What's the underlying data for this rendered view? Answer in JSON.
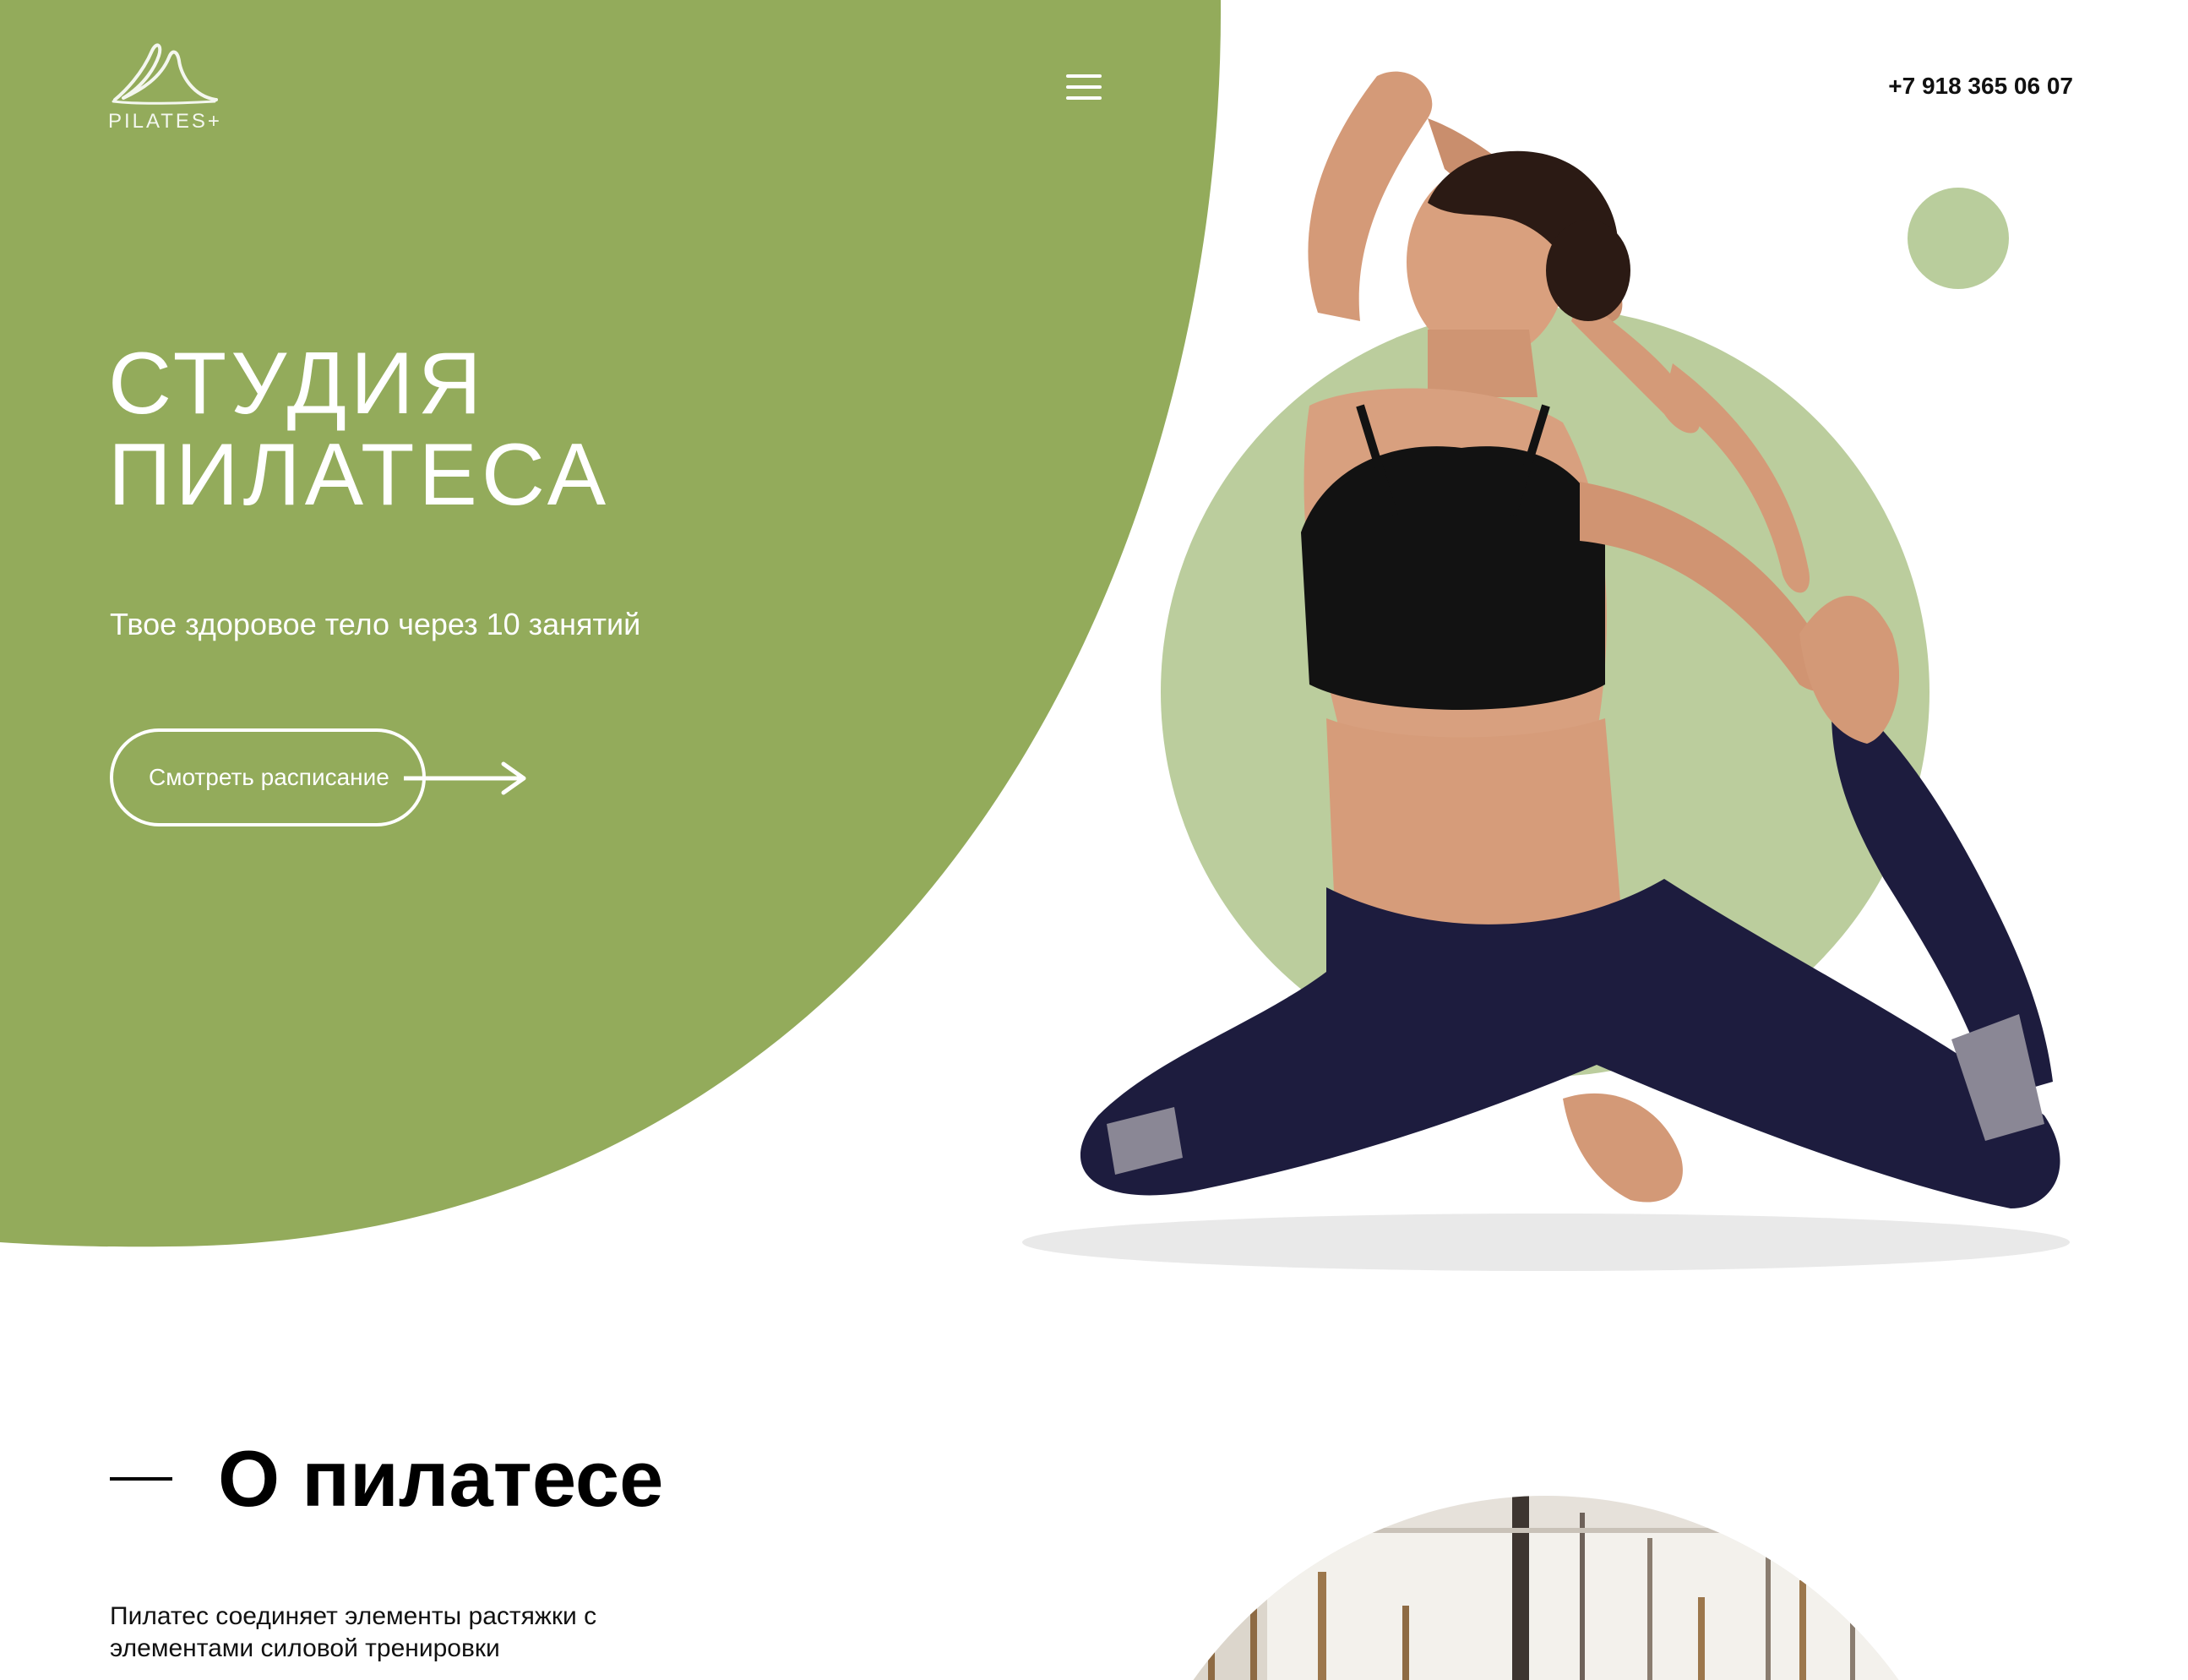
{
  "header": {
    "logo_text": "PILATES+",
    "phone": "+7 918 365 06 07",
    "menu_icon": "hamburger-icon"
  },
  "hero": {
    "title_line1": "СТУДИЯ",
    "title_line2": "ПИЛАТЕСА",
    "subtitle": "Твое здоровое тело через 10 занятий",
    "schedule_button": "Смотреть расписание",
    "arrow_icon": "arrow-right-icon"
  },
  "about": {
    "title": "О пилатесе",
    "text": "Пилатес соединяет элементы растяжки с элементами силовой тренировки"
  },
  "colors": {
    "accent_green": "#93ab5b",
    "light_green": "#bbcd9d",
    "text_dark": "#111111",
    "background": "#ffffff"
  }
}
